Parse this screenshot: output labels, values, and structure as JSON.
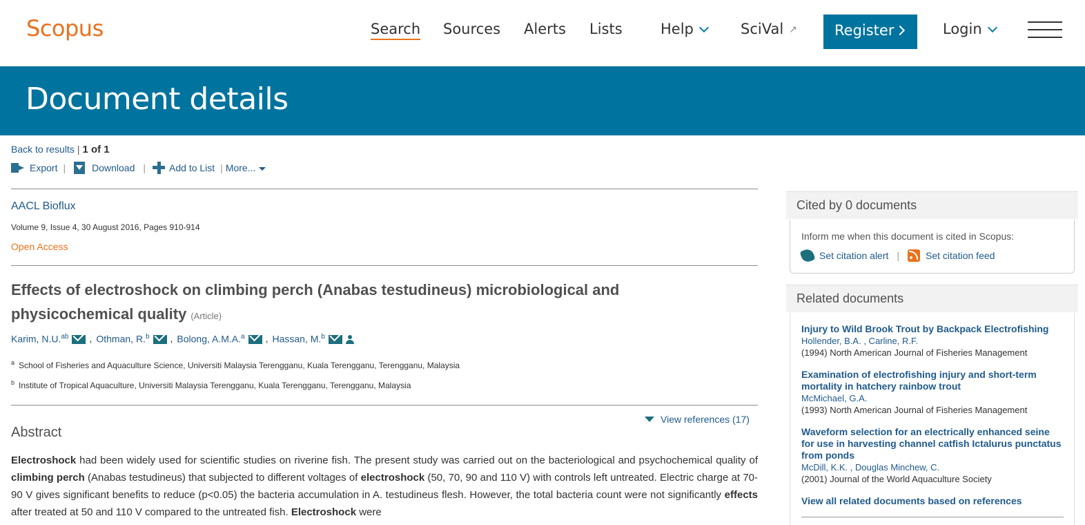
{
  "header": {
    "logo": "Scopus",
    "nav": {
      "search": "Search",
      "sources": "Sources",
      "alerts": "Alerts",
      "lists": "Lists",
      "help": "Help",
      "scival": "SciVal",
      "register": "Register",
      "login": "Login"
    }
  },
  "banner": {
    "title": "Document details"
  },
  "actions": {
    "back": "Back to results",
    "separator": "|",
    "position": "1 of 1",
    "export": "Export",
    "download": "Download",
    "add_to_list": "Add to List",
    "more": "More..."
  },
  "doc": {
    "journal": "AACL Bioflux",
    "volume": "Volume 9, Issue 4, 30 August 2016, Pages 910-914",
    "open_access": "Open Access",
    "title_line1": "Effects of electroshock on climbing perch (Anabas testudineus) microbiological and",
    "title_line2": "physicochemical quality",
    "type": "(Article)",
    "authors": [
      {
        "name": "Karim, N.U.",
        "sup": "ab"
      },
      {
        "name": "Othman, R.",
        "sup": "b"
      },
      {
        "name": "Bolong, A.M.A.",
        "sup": "a"
      },
      {
        "name": "Hassan, M.",
        "sup": "b"
      }
    ],
    "affiliations": [
      {
        "key": "a",
        "text": "School of Fisheries and Aquaculture Science, Universiti Malaysia Terengganu, Kuala Terengganu, Terengganu, Malaysia"
      },
      {
        "key": "b",
        "text": "Institute of Tropical Aquaculture, Universiti Malaysia Terengganu, Kuala Terengganu, Terengganu, Malaysia"
      }
    ],
    "view_references": "View references (17)",
    "abstract_heading": "Abstract",
    "abstract": {
      "p1_b1": "Electroshock",
      "p1_t1": " had been widely used for scientific studies on riverine fish. The present study was carried out on the bacteriological and psychochemical quality of ",
      "p1_b2": "climbing perch",
      "p1_t2": " (Anabas testudineus) that subjected to different voltages of ",
      "p1_b3": "electroshock",
      "p1_t3": " (50, 70, 90 and 110 V) with controls left untreated. Electric charge at 70-90 V gives significant benefits to reduce (p<0.05) the bacteria accumulation in A. testudineus flesh. However, the total bacteria count were not significantly ",
      "p1_b4": "effects",
      "p1_t4": " after treated at 50 and 110 V compared to the untreated fish. ",
      "p1_b5": "Electroshock",
      "p1_t5": " were"
    }
  },
  "cited": {
    "heading": "Cited by 0 documents",
    "inform": "Inform me when this document is cited in Scopus:",
    "alert": "Set citation alert",
    "pipe": "|",
    "feed": "Set citation feed"
  },
  "related": {
    "heading": "Related documents",
    "items": [
      {
        "title": "Injury to Wild Brook Trout by Backpack Electrofishing",
        "authors": "Hollender, B.A. , Carline, R.F.",
        "source": "(1994) North American Journal of Fisheries Management"
      },
      {
        "title": "Examination of electrofishing injury and short-term mortality in hatchery rainbow trout",
        "authors": "McMichael, G.A.",
        "source": "(1993) North American Journal of Fisheries Management"
      },
      {
        "title": "Waveform selection for an electrically enhanced seine for use in harvesting channel catfish Ictalurus punctatus from ponds",
        "authors": "McDill, K.K. , Douglas Minchew, C.",
        "source": "(2001) Journal of the World Aquaculture Society"
      }
    ],
    "view_all": "View all related documents based on references"
  }
}
